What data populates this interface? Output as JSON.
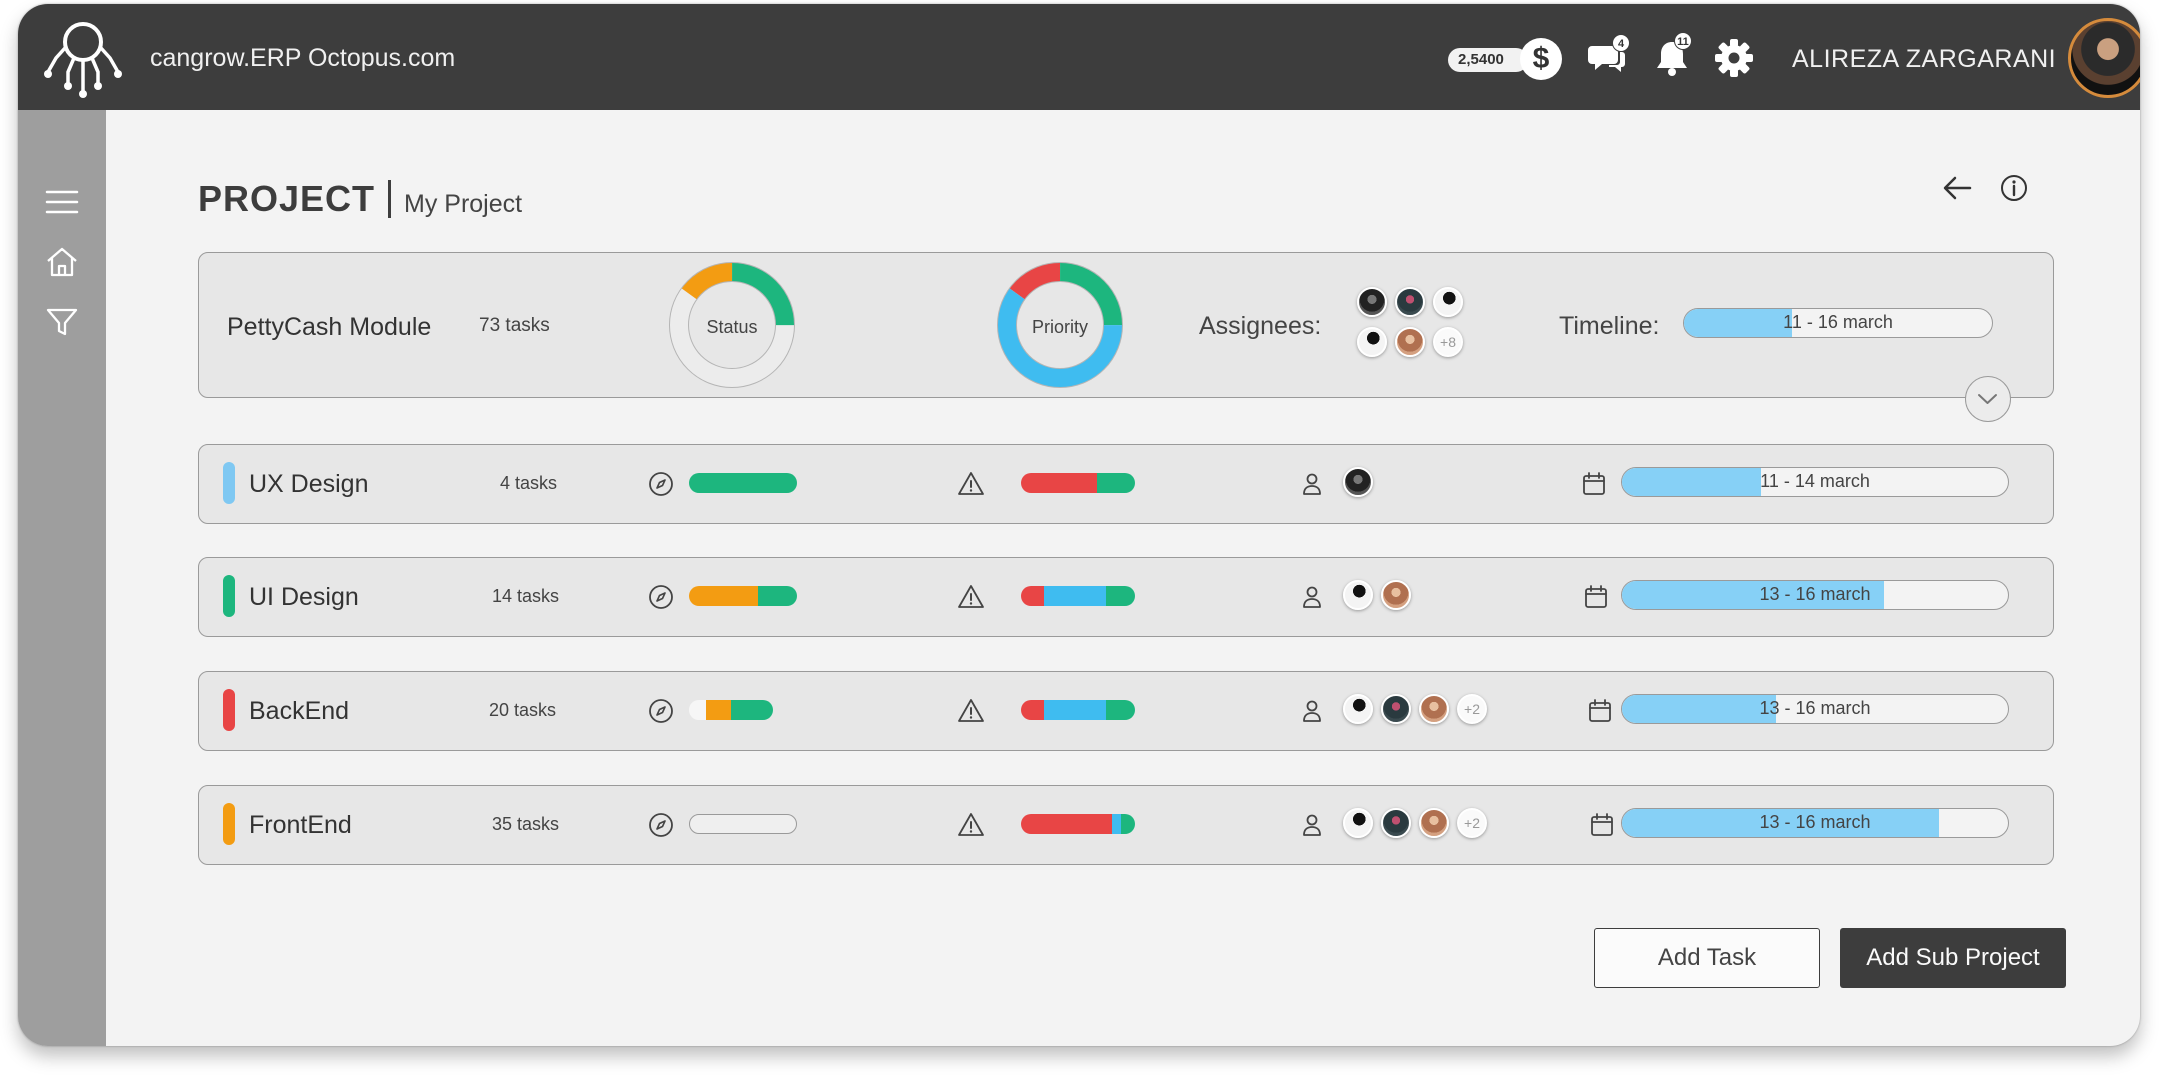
{
  "app": {
    "title": "cangrow.ERP Octopus.com",
    "balance": "2,5400",
    "currency_symbol": "$",
    "messages_count": "4",
    "notifications_count": "11",
    "user_name": "ALIREZA ZARGARANI"
  },
  "page": {
    "title": "PROJECT",
    "subtitle": "My Project"
  },
  "summary": {
    "name": "PettyCash Module",
    "tasks": "73 tasks",
    "status_label": "Status",
    "priority_label": "Priority",
    "assignees_label": "Assignees:",
    "assignees_more": "+8",
    "timeline_label": "Timeline:",
    "timeline_text": "11 - 16 march",
    "timeline_progress": 0.35,
    "status_donut": [
      {
        "color": "#f39c12",
        "value": 0.15
      },
      {
        "color": "#1db67e",
        "value": 0.25
      },
      {
        "color": "none",
        "value": 0.6
      }
    ],
    "priority_donut": [
      {
        "color": "#e84545",
        "value": 0.15
      },
      {
        "color": "#1db67e",
        "value": 0.25
      },
      {
        "color": "#3fbcf0",
        "value": 0.6
      }
    ]
  },
  "rows": [
    {
      "name": "UX Design",
      "tasks": "4 tasks",
      "accent": "#7fc8f2",
      "status": [
        {
          "color": "#1db67e",
          "value": 1
        }
      ],
      "priority": [
        {
          "color": "#e84545",
          "value": 0.67
        },
        {
          "color": "#1db67e",
          "value": 0.33
        }
      ],
      "more": "",
      "timeline": "11 - 14 march",
      "timeline_progress": 0.36
    },
    {
      "name": "UI Design",
      "tasks": "14 tasks",
      "accent": "#1db67e",
      "status": [
        {
          "color": "#f39c12",
          "value": 0.64
        },
        {
          "color": "#1db67e",
          "value": 0.36
        }
      ],
      "priority": [
        {
          "color": "#e84545",
          "value": 0.2
        },
        {
          "color": "#3fbcf0",
          "value": 0.55
        },
        {
          "color": "#1db67e",
          "value": 0.25
        }
      ],
      "more": "",
      "timeline": "13 - 16 march",
      "timeline_progress": 0.68
    },
    {
      "name": "BackEnd",
      "tasks": "20 tasks",
      "accent": "#e84545",
      "status": [
        {
          "color": "#f6f6f6",
          "value": 0.2
        },
        {
          "color": "#f39c12",
          "value": 0.3
        },
        {
          "color": "#1db67e",
          "value": 0.5
        }
      ],
      "priority": [
        {
          "color": "#e84545",
          "value": 0.2
        },
        {
          "color": "#3fbcf0",
          "value": 0.55
        },
        {
          "color": "#1db67e",
          "value": 0.25
        }
      ],
      "more": "+2",
      "timeline": "13 - 16 march",
      "timeline_progress": 0.4
    },
    {
      "name": "FrontEnd",
      "tasks": "35 tasks",
      "accent": "#f39c12",
      "status": [],
      "priority": [
        {
          "color": "#e84545",
          "value": 0.8
        },
        {
          "color": "#3fbcf0",
          "value": 0.08
        },
        {
          "color": "#1db67e",
          "value": 0.12
        }
      ],
      "more": "+2",
      "timeline": "13 - 16 march",
      "timeline_progress": 0.82
    }
  ],
  "actions": {
    "add_task": "Add Task",
    "add_sub_project": "Add Sub Project"
  }
}
